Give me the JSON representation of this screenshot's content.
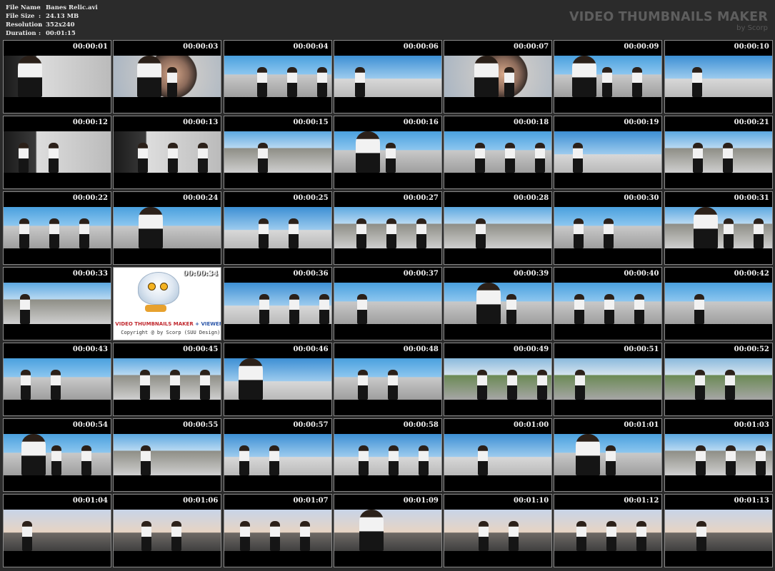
{
  "info": {
    "rows": [
      {
        "label": "File Name",
        "sep": ":",
        "value": "Banes Relic.avi"
      },
      {
        "label": "File Size",
        "sep": ":",
        "value": "24.13 MB"
      },
      {
        "label": "Resolution",
        "sep": ":",
        "value": "352x240"
      },
      {
        "label": "Duration",
        "sep": ":",
        "value": "00:01:15"
      }
    ]
  },
  "brand": {
    "title": "VIDEO THUMBNAILS MAKER",
    "subtitle": "by Scorp"
  },
  "logo": {
    "line1a": "VIDEO THUMBNAILS MAKER",
    "line1b": "+ VIEWER",
    "line2": "Copyright @ by Scorp (SUU Design)"
  },
  "thumbnails": [
    {
      "time": "00:00:01",
      "scene": "car"
    },
    {
      "time": "00:00:03",
      "scene": "face"
    },
    {
      "time": "00:00:04",
      "scene": "sky-a"
    },
    {
      "time": "00:00:06",
      "scene": "sky-b"
    },
    {
      "time": "00:00:07",
      "scene": "face"
    },
    {
      "time": "00:00:09",
      "scene": "sky-a"
    },
    {
      "time": "00:00:10",
      "scene": "sky-b"
    },
    {
      "time": "00:00:12",
      "scene": "car"
    },
    {
      "time": "00:00:13",
      "scene": "car"
    },
    {
      "time": "00:00:15",
      "scene": "sky-c"
    },
    {
      "time": "00:00:16",
      "scene": "sky-a"
    },
    {
      "time": "00:00:18",
      "scene": "sky-a"
    },
    {
      "time": "00:00:19",
      "scene": "sky-b"
    },
    {
      "time": "00:00:21",
      "scene": "sky-c"
    },
    {
      "time": "00:00:22",
      "scene": "sky-a"
    },
    {
      "time": "00:00:24",
      "scene": "sky-a"
    },
    {
      "time": "00:00:25",
      "scene": "sky-b"
    },
    {
      "time": "00:00:27",
      "scene": "sky-c"
    },
    {
      "time": "00:00:28",
      "scene": "sky-c"
    },
    {
      "time": "00:00:30",
      "scene": "sky-a"
    },
    {
      "time": "00:00:31",
      "scene": "sky-c"
    },
    {
      "time": "00:00:33",
      "scene": "sky-c"
    },
    {
      "time": "00:00:34",
      "scene": "logo"
    },
    {
      "time": "00:00:36",
      "scene": "sky-b"
    },
    {
      "time": "00:00:37",
      "scene": "sky-a"
    },
    {
      "time": "00:00:39",
      "scene": "sky-a"
    },
    {
      "time": "00:00:40",
      "scene": "sky-a"
    },
    {
      "time": "00:00:42",
      "scene": "sky-a"
    },
    {
      "time": "00:00:43",
      "scene": "sky-a"
    },
    {
      "time": "00:00:45",
      "scene": "sky-c"
    },
    {
      "time": "00:00:46",
      "scene": "sky-b"
    },
    {
      "time": "00:00:48",
      "scene": "sky-a"
    },
    {
      "time": "00:00:49",
      "scene": "hills"
    },
    {
      "time": "00:00:51",
      "scene": "hills"
    },
    {
      "time": "00:00:52",
      "scene": "hills"
    },
    {
      "time": "00:00:54",
      "scene": "sky-a"
    },
    {
      "time": "00:00:55",
      "scene": "sky-c"
    },
    {
      "time": "00:00:57",
      "scene": "sky-b"
    },
    {
      "time": "00:00:58",
      "scene": "sky-b"
    },
    {
      "time": "00:01:00",
      "scene": "sky-b"
    },
    {
      "time": "00:01:01",
      "scene": "sky-a"
    },
    {
      "time": "00:01:03",
      "scene": "sky-c"
    },
    {
      "time": "00:01:04",
      "scene": "dawn"
    },
    {
      "time": "00:01:06",
      "scene": "dawn"
    },
    {
      "time": "00:01:07",
      "scene": "dawn"
    },
    {
      "time": "00:01:09",
      "scene": "dawn"
    },
    {
      "time": "00:01:10",
      "scene": "dawn"
    },
    {
      "time": "00:01:12",
      "scene": "dawn"
    },
    {
      "time": "00:01:13",
      "scene": "dawn"
    }
  ]
}
